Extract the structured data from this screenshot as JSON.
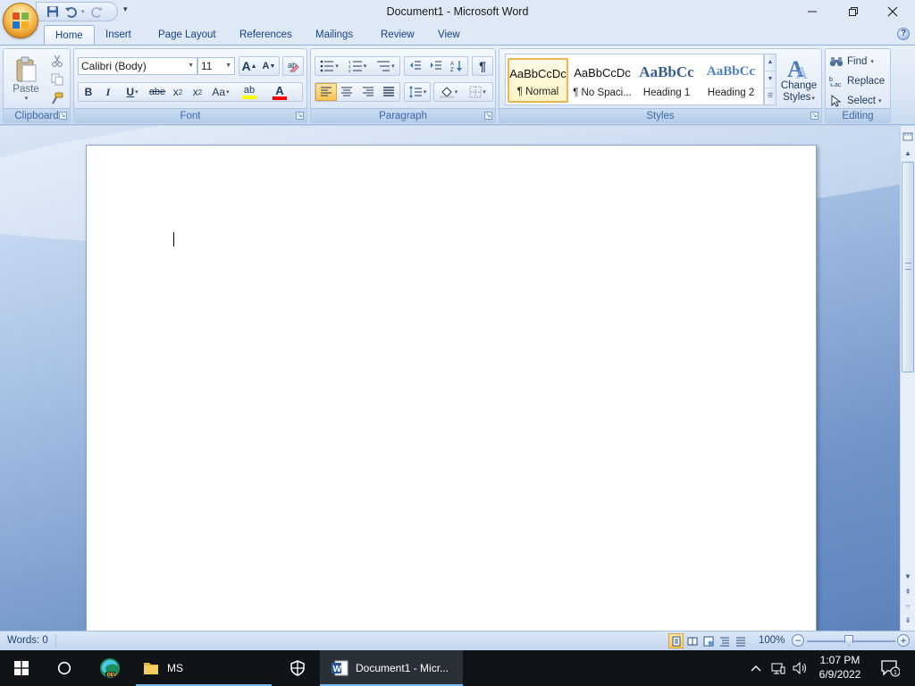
{
  "window": {
    "title": "Document1 - Microsoft Word",
    "controls": {
      "minimize": "—",
      "maximize": "❐",
      "close": "✕"
    }
  },
  "quick_access": {
    "save_icon": "save-icon",
    "undo_icon": "undo-icon",
    "redo_icon": "redo-icon",
    "customize_glyph": "▾"
  },
  "tabs": [
    {
      "label": "Home",
      "active": true
    },
    {
      "label": "Insert"
    },
    {
      "label": "Page Layout"
    },
    {
      "label": "References"
    },
    {
      "label": "Mailings"
    },
    {
      "label": "Review"
    },
    {
      "label": "View"
    }
  ],
  "ribbon": {
    "clipboard": {
      "label": "Clipboard",
      "paste_label": "Paste"
    },
    "font": {
      "label": "Font",
      "font_name": "Calibri (Body)",
      "font_size": "11",
      "grow_label": "A",
      "shrink_label": "A",
      "bold": "B",
      "italic": "I",
      "underline": "U",
      "strikethrough": "abe",
      "subscript": "x",
      "superscript": "x",
      "change_case": "Aa",
      "highlight": "ab",
      "font_color": "A",
      "highlight_color": "#ffff00",
      "font_color_value": "#ff0000"
    },
    "paragraph": {
      "label": "Paragraph",
      "show_marks": "¶"
    },
    "styles": {
      "label": "Styles",
      "items": [
        {
          "sample": "AaBbCcDc",
          "name": "¶ Normal",
          "selected": true
        },
        {
          "sample": "AaBbCcDc",
          "name": "¶ No Spaci..."
        },
        {
          "sample": "AaBbCc",
          "name": "Heading 1"
        },
        {
          "sample": "AaBbCc",
          "name": "Heading 2"
        }
      ],
      "change_styles_line1": "Change",
      "change_styles_line2": "Styles"
    },
    "editing": {
      "label": "Editing",
      "find": "Find",
      "replace": "Replace",
      "select": "Select"
    }
  },
  "status": {
    "words": "Words: 0",
    "zoom": "100%",
    "zoom_minus": "−",
    "zoom_plus": "+"
  },
  "taskbar": {
    "folder_label": "MS",
    "word_label": "Document1 - Micr...",
    "time": "1:07 PM",
    "date": "6/9/2022",
    "notification_count": "1"
  },
  "colors": {
    "ribbon_text": "#15428b",
    "selected_style_border": "#f0b452",
    "taskbar": "#101418"
  }
}
